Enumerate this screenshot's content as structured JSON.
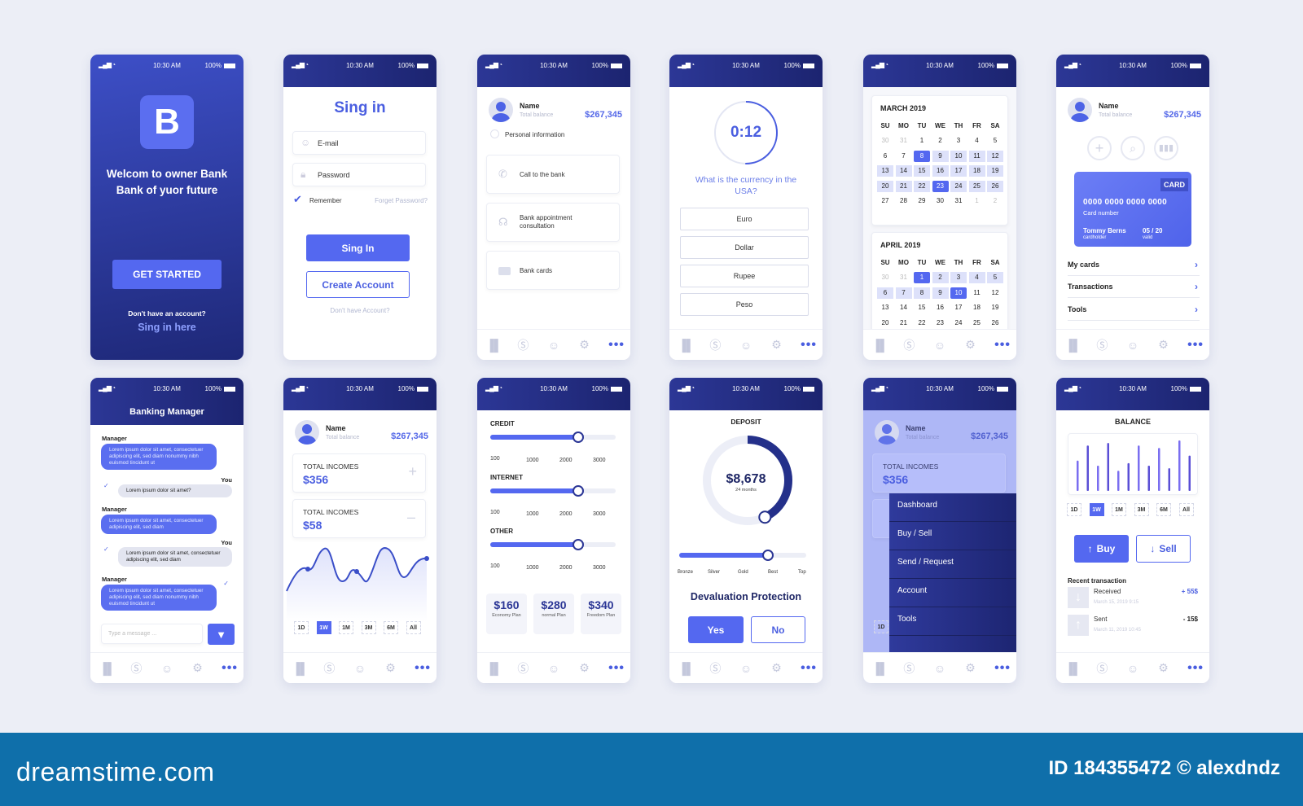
{
  "status": {
    "time": "10:30 AM",
    "battery": "100%",
    "signal": "▂▄▆ ◔"
  },
  "nav": {
    "icons": [
      "chart-icon",
      "dollar-icon",
      "user-icon",
      "gear-icon",
      "more-icon"
    ],
    "glyphs": [
      "▐▌",
      "Ⓢ",
      "☺",
      "⚙",
      "•••"
    ]
  },
  "profile": {
    "name": "Name",
    "subtitle": "Total balance",
    "amount": "$267,345"
  },
  "welcome": {
    "logo": "B",
    "title": "Welcom to owner Bank Bank of yuor future",
    "cta": "GET STARTED",
    "prompt": "Don't have an account?",
    "link": "Sing in here"
  },
  "signin": {
    "title": "Sing in",
    "email_placeholder": "E-mail",
    "password_placeholder": "Password",
    "remember": "Remember",
    "forgot": "Forget Password?",
    "submit": "Sing In",
    "create": "Create Account",
    "no_account": "Don't have Account?"
  },
  "support": {
    "personal": "Personal information",
    "items": [
      "Call to the bank",
      "Bank appointment consultation",
      "Bank cards"
    ]
  },
  "quiz": {
    "timer": "0:12",
    "question": "What is the currency in the USA?",
    "options": [
      "Euro",
      "Dollar",
      "Rupee",
      "Peso"
    ]
  },
  "calendar": {
    "weekdays": [
      "SU",
      "MO",
      "TU",
      "WE",
      "TH",
      "FR",
      "SA"
    ],
    "months": [
      {
        "title": "MARCH 2019",
        "weeks": [
          [
            30,
            31,
            1,
            2,
            3,
            4,
            5
          ],
          [
            6,
            7,
            8,
            9,
            10,
            11,
            12
          ],
          [
            13,
            14,
            15,
            16,
            17,
            18,
            19
          ],
          [
            20,
            21,
            22,
            23,
            24,
            25,
            26
          ],
          [
            27,
            28,
            29,
            30,
            31,
            1,
            2
          ]
        ],
        "selected": [
          8,
          23
        ],
        "range": [
          8,
          26
        ]
      },
      {
        "title": "APRIL 2019",
        "weeks": [
          [
            30,
            31,
            1,
            2,
            3,
            4,
            5
          ],
          [
            6,
            7,
            8,
            9,
            10,
            11,
            12
          ],
          [
            13,
            14,
            15,
            16,
            17,
            18,
            19
          ],
          [
            20,
            21,
            22,
            23,
            24,
            25,
            26
          ]
        ],
        "selected": [
          1,
          10
        ],
        "range": [
          1,
          10
        ]
      }
    ]
  },
  "cardscreen": {
    "badge": "CARD",
    "number": "0000 0000 0000 0000",
    "number_label": "Card number",
    "holder": "Tommy Berns",
    "holder_label": "cardholder",
    "valid": "05 / 20",
    "valid_label": "valid",
    "menu": [
      "My cards",
      "Transactions",
      "Tools"
    ]
  },
  "chat": {
    "title": "Banking Manager",
    "manager": "Manager",
    "you": "You",
    "messages": [
      "Lorem ipsum dolor sit amet, consectetuer adipiscing elit, sed diam nonummy nibh euismod tincidunt ut",
      "Lorem ipsum dolor sit amet?",
      "Lorem ipsum dolor sit amet, consectetuer adipiscing elit, sed diam",
      "Lorem ipsum dolor sit amet, consectetuer adipiscing elit, sed diam",
      "Lorem ipsum dolor sit amet, consectetuer adipiscing elit, sed diam nonummy nibh euismod tincidunt ut"
    ],
    "input_placeholder": "Type a message ..."
  },
  "incomes": {
    "label": "TOTAL INCOMES",
    "values": [
      "$356",
      "$58"
    ],
    "periods": [
      "1D",
      "1W",
      "1M",
      "3M",
      "6M",
      "All"
    ],
    "active_period": "1W"
  },
  "sliders": {
    "groups": [
      {
        "label": "CREDIT",
        "value_fraction": 0.7
      },
      {
        "label": "INTERNET",
        "value_fraction": 0.7
      },
      {
        "label": "OTHER",
        "value_fraction": 0.7
      }
    ],
    "ticks": [
      "100",
      "1000",
      "2000",
      "3000"
    ],
    "plans": [
      {
        "price": "$160",
        "name": "Economy Plan"
      },
      {
        "price": "$280",
        "name": "normal Plan"
      },
      {
        "price": "$340",
        "name": "Freedom Plan"
      }
    ]
  },
  "deposit": {
    "title": "DEPOSIT",
    "amount": "$8,678",
    "term": "24 months",
    "progress_fraction": 0.43,
    "levels": [
      "Bronze",
      "Silver",
      "Gold",
      "Best",
      "Top"
    ],
    "level_fraction": 0.7,
    "question": "Devaluation Protection",
    "yes": "Yes",
    "no": "No"
  },
  "menu": {
    "items": [
      "Dashboard",
      "Buy / Sell",
      "Send / Request",
      "Account",
      "Tools"
    ]
  },
  "balance": {
    "title": "BALANCE",
    "bars": [
      0.6,
      0.9,
      0.5,
      0.95,
      0.4,
      0.55,
      0.9,
      0.5,
      0.85,
      0.45,
      1.0,
      0.7
    ],
    "buy": "Buy",
    "sell": "Sell",
    "recent": "Recent transaction",
    "transactions": [
      {
        "label": "Received",
        "date": "March 15, 2019 9:15",
        "amount": "+ 55$"
      },
      {
        "label": "Sent",
        "date": "March 11, 2019 10:45",
        "amount": "- 15$"
      }
    ]
  },
  "footer": {
    "brand": "dreamstime.com",
    "credit": "ID 184355472 © alexdndz"
  },
  "colors": {
    "accent": "#5468f0",
    "navy": "#1c2470",
    "footer": "#0f6faa"
  }
}
